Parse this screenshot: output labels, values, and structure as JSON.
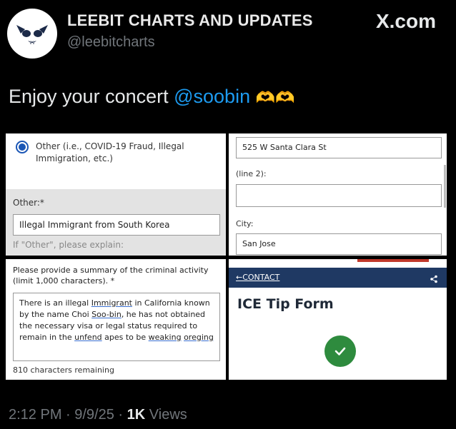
{
  "author": {
    "display_name": "LEEBIT CHARTS AND UPDATES",
    "handle": "@leebitcharts"
  },
  "brand": "X.com",
  "tweet": {
    "text": "Enjoy your concert ",
    "mention": "@soobin",
    "emoji": "🫶🫶"
  },
  "panel_other": {
    "option_label": "Other (i.e., COVID-19 Fraud, Illegal Immigration, etc.)",
    "other_label": "Other:*",
    "other_value": "Illegal Immigrant from South Korea",
    "help_text": "If \"Other\", please explain:"
  },
  "panel_address": {
    "street_value": "525 W Santa Clara St",
    "line2_label": "(line 2):",
    "line2_value": "",
    "city_label": "City:",
    "city_value": "San Jose"
  },
  "panel_summary": {
    "label": "Please provide a summary of the criminal activity (limit 1,000 characters). *",
    "text_part1": "There is an illegal ",
    "text_u1": "Immigrant",
    "text_part2": " in California known by the name Choi ",
    "text_u2": "Soo-bin",
    "text_part3": ", he has not obtained the necessary visa or legal status required to remain in the ",
    "text_u3": "unfend",
    "text_part4": " apes to be ",
    "text_u4": "weaking",
    "text_part5": " ",
    "text_u5": "oreging",
    "remaining": "810 characters remaining"
  },
  "panel_form": {
    "back_link": "←CONTACT",
    "title": "ICE Tip Form",
    "share_icon": "share-icon",
    "success_icon": "checkmark-circle-icon"
  },
  "meta": {
    "time": "2:12 PM · 9/9/25 · ",
    "views_count": "1K",
    "views_label": " Views"
  }
}
